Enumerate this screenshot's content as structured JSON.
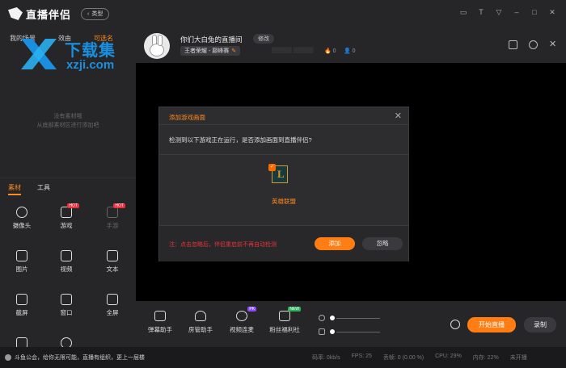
{
  "app": {
    "name": "直播伴侣",
    "type_button": "类型"
  },
  "watermark": {
    "cn": "下载集",
    "en": "xzji.com"
  },
  "scenes": {
    "tabs": [
      "我的场景",
      "效由",
      "可选名"
    ],
    "empty_hint_1": "没有素材哦",
    "empty_hint_2": "从底部素材区进行添加吧"
  },
  "material_tabs": [
    "素材",
    "工具"
  ],
  "materials": [
    {
      "label": "摄像头",
      "icon": "camera-icon",
      "hot": false,
      "disabled": false
    },
    {
      "label": "游戏",
      "icon": "gamepad-icon",
      "hot": true,
      "disabled": false
    },
    {
      "label": "手游",
      "icon": "phone-icon",
      "hot": true,
      "disabled": true
    },
    {
      "label": "图片",
      "icon": "image-icon",
      "hot": false,
      "disabled": false
    },
    {
      "label": "视频",
      "icon": "video-icon",
      "hot": false,
      "disabled": false
    },
    {
      "label": "文本",
      "icon": "text-icon",
      "hot": false,
      "disabled": false
    },
    {
      "label": "截屏",
      "icon": "crop-icon",
      "hot": false,
      "disabled": false
    },
    {
      "label": "窗口",
      "icon": "window-icon",
      "hot": false,
      "disabled": false
    },
    {
      "label": "全屏",
      "icon": "fullscreen-icon",
      "hot": false,
      "disabled": false
    }
  ],
  "hot_badge": "HOT",
  "room": {
    "title": "你们大白兔的直播间",
    "edit_label": "修改",
    "category": "王者荣耀 - 巅峰赛",
    "likes": "0",
    "viewers": "0"
  },
  "modal": {
    "title": "添加游戏画面",
    "message": "检测到以下游戏正在运行，是否添加画面到直播伴侣?",
    "game_name": "英雄联盟",
    "note": "注：点击忽略后，伴侣重启前不再自动检测",
    "add_label": "添加",
    "ignore_label": "忽略"
  },
  "bottom_tools": [
    {
      "label": "弹幕助手",
      "icon": "danmaku-icon",
      "badge": "",
      "badge_color": ""
    },
    {
      "label": "房管助手",
      "icon": "room-admin-icon",
      "badge": "",
      "badge_color": ""
    },
    {
      "label": "视频连麦",
      "icon": "video-call-icon",
      "badge": "PK",
      "badge_color": "#8a4bff"
    },
    {
      "label": "粉丝福利社",
      "icon": "gift-icon",
      "badge": "NEW",
      "badge_color": "#2bb35a"
    }
  ],
  "actions": {
    "live_label": "开始直播",
    "record_label": "录制"
  },
  "status": {
    "news": "斗鱼公会，给你无限可能，直播有组织，更上一层楼",
    "bitrate": "码率: 0kb/s",
    "fps": "FPS: 25",
    "dropped": "丢帧: 0 (0.00 %)",
    "cpu": "CPU: 29%",
    "memory": "内存: 22%",
    "live_state": "未开播"
  },
  "colors": {
    "accent": "#ff7d12",
    "danger": "#e8323c",
    "background": "#1e1e20"
  }
}
